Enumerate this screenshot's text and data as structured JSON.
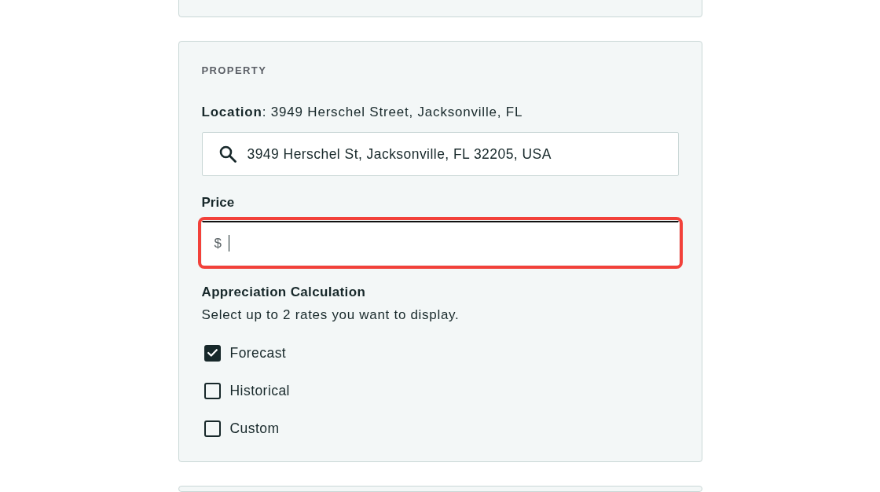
{
  "property": {
    "heading": "PROPERTY",
    "location_line": "**Location**: 3949 Herschel Street, Jacksonville, FL",
    "search": {
      "value": "3949 Herschel St, Jacksonville, FL 32205, USA"
    },
    "price": {
      "label": "Price",
      "prefix": "$",
      "focused": true,
      "highlighted": true
    },
    "appreciation": {
      "title": "Appreciation Calculation",
      "hint": "Select up to 2 rates you want to display.",
      "options": [
        {
          "label": "Forecast",
          "checked": true
        },
        {
          "label": "Historical",
          "checked": false
        },
        {
          "label": "Custom",
          "checked": false
        }
      ]
    }
  }
}
